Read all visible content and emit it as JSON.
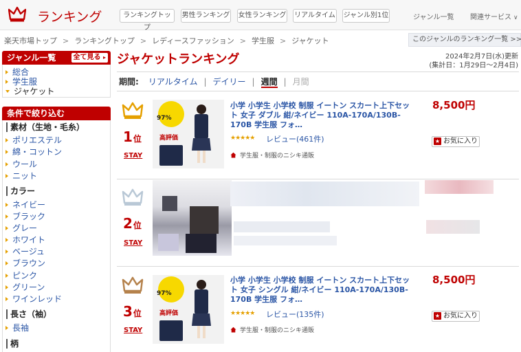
{
  "header": {
    "logo_text": "ランキング",
    "tabs": [
      "ランキングトップ",
      "男性ランキング",
      "女性ランキング",
      "リアルタイム",
      "ジャンル別1位"
    ],
    "genre_list_link": "ジャンル一覧",
    "related_services": "関連サービス"
  },
  "breadcrumb": [
    "楽天市場トップ",
    "ランキングトップ",
    "レディースファッション",
    "学生服",
    "ジャケット"
  ],
  "genre_ranking_link": "このジャンルのランキング一覧 >>",
  "sidebar": {
    "genre_header": "ジャンル一覧",
    "see_all_button": "全て見る",
    "genres": [
      "総合",
      "学生服",
      "ジャケット"
    ],
    "filter_header": "条件で絞り込む",
    "groups": [
      {
        "title": "素材（生地・毛糸）",
        "items": [
          "ポリエステル",
          "綿・コットン",
          "ウール",
          "ニット"
        ]
      },
      {
        "title": "カラー",
        "items": [
          "ネイビー",
          "ブラック",
          "グレー",
          "ホワイト",
          "ベージュ",
          "ブラウン",
          "ピンク",
          "グリーン",
          "ワインレッド"
        ]
      },
      {
        "title": "長さ（袖）",
        "items": [
          "長袖"
        ]
      },
      {
        "title": "柄",
        "items": []
      }
    ]
  },
  "main": {
    "title": "ジャケットランキング",
    "updated_line1": "2024年2月7日(水)更新",
    "updated_line2": "(集計日：1月29日～2月4日)",
    "period_label": "期間:",
    "periods": [
      "リアルタイム",
      "デイリー",
      "週間",
      "月間"
    ],
    "selected_period": "週間",
    "items": [
      {
        "rank": "1",
        "rank_suffix": "位",
        "movement": "STAY",
        "title": "小学 小学生 小学校 制服 イートン スカート上下セット 女子 ダブル 紺/ネイビー 110A-170A/130B-170B 学生服 フォ…",
        "stars": "★★★★★",
        "review": "レビュー(461件)",
        "shop": "学生服・制服のニシキ通販",
        "price": "8,500円",
        "favorite": "お気に入り",
        "thumb_pct": "97%",
        "thumb_text": "高評価"
      },
      {
        "rank": "2",
        "rank_suffix": "位",
        "movement": "STAY"
      },
      {
        "rank": "3",
        "rank_suffix": "位",
        "movement": "STAY",
        "title": "小学 小学生 小学校 制服 イートン スカート上下セット 女子 シングル 紺/ネイビー 110A-170A/130B-170B 学生服 フォ…",
        "stars": "★★★★★",
        "review": "レビュー(135件)",
        "shop": "学生服・制服のニシキ通販",
        "price": "8,500円",
        "favorite": "お気に入り",
        "thumb_pct": "97%",
        "thumb_text": "高評価"
      }
    ]
  },
  "colors": {
    "accent": "#bf0000",
    "link": "#2a55a5",
    "gold": "#e5a000",
    "silver": "#b9c8d6",
    "bronze": "#b5824c"
  }
}
